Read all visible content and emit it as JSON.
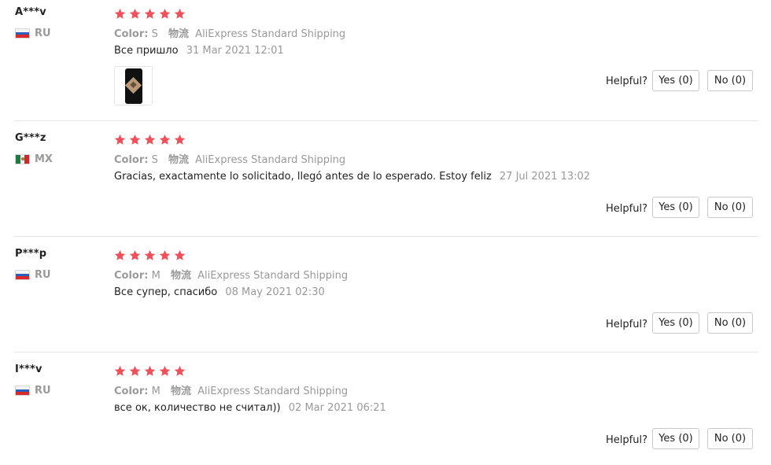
{
  "colors": {
    "star": "#f0505a",
    "divider": "#e5e5e5",
    "muted": "#999999"
  },
  "helpful_label": "Helpful?",
  "reviews": [
    {
      "user": "A***v",
      "country": "RU",
      "rating": 5,
      "color_label": "Color:",
      "color_value": "S",
      "shipping_label": "物流",
      "shipping_value": "AliExpress Standard Shipping",
      "text": "Все пришло",
      "date": "31 Mar 2021 12:01",
      "has_photo": true,
      "yes": "Yes (0)",
      "no": "No (0)"
    },
    {
      "user": "G***z",
      "country": "MX",
      "rating": 5,
      "color_label": "Color:",
      "color_value": "S",
      "shipping_label": "物流",
      "shipping_value": "AliExpress Standard Shipping",
      "text": "Gracias, exactamente lo solicitado, llegó antes de lo esperado. Estoy feliz",
      "date": "27 Jul 2021 13:02",
      "has_photo": false,
      "yes": "Yes (0)",
      "no": "No (0)"
    },
    {
      "user": "P***p",
      "country": "RU",
      "rating": 5,
      "color_label": "Color:",
      "color_value": "M",
      "shipping_label": "物流",
      "shipping_value": "AliExpress Standard Shipping",
      "text": "Все супер, спасибо",
      "date": "08 May 2021 02:30",
      "has_photo": false,
      "yes": "Yes (0)",
      "no": "No (0)"
    },
    {
      "user": "I***v",
      "country": "RU",
      "rating": 5,
      "color_label": "Color:",
      "color_value": "M",
      "shipping_label": "物流",
      "shipping_value": "AliExpress Standard Shipping",
      "text": "все ок, количество не считал))",
      "date": "02 Mar 2021 06:21",
      "has_photo": false,
      "yes": "Yes (0)",
      "no": "No (0)"
    }
  ]
}
